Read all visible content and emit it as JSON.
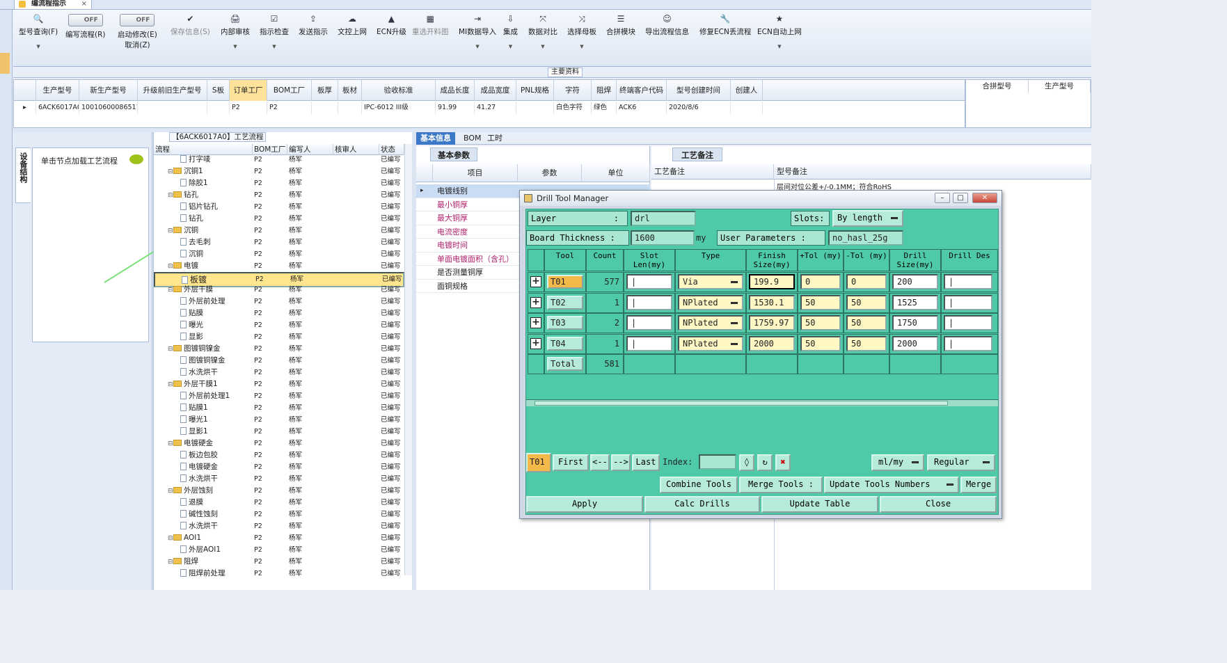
{
  "window": {
    "tab_title": "编流程指示",
    "close_glyph": "×"
  },
  "toolbar": {
    "items": [
      {
        "label": "型号查询(F)",
        "icon": "🔍"
      },
      {
        "label": "编写流程(R)",
        "toggle": "OFF"
      },
      {
        "label": "启动修改(E)",
        "label2": "取消(Z)",
        "toggle": "OFF"
      },
      {
        "label": "保存信息(S)",
        "icon": "✔"
      },
      {
        "label": "内部审核",
        "icon": "🖨"
      },
      {
        "label": "指示检查",
        "icon": "☑"
      },
      {
        "label": "发送指示",
        "icon": "⇪"
      },
      {
        "label": "文控上网",
        "icon": "☁"
      },
      {
        "label": "ECN升级",
        "icon": "▲"
      },
      {
        "label": "重选开料图",
        "icon": "▦"
      },
      {
        "label": "MI数据导入",
        "icon": "⇥"
      },
      {
        "label": "集成",
        "icon": "⇩"
      },
      {
        "label": "数据对比",
        "icon": "⤧"
      },
      {
        "label": "选择母板",
        "icon": "⤨"
      },
      {
        "label": "合拼模块",
        "icon": "☰"
      },
      {
        "label": "导出流程信息",
        "icon": "☺"
      },
      {
        "label": "修复ECN丢流程",
        "icon": "🔧"
      },
      {
        "label": "ECN自动上网",
        "icon": "★"
      }
    ]
  },
  "main_grid": {
    "title": "主要资料",
    "headers": [
      "生产型号",
      "新生产型号",
      "升级前旧生产型号",
      "S板",
      "订单工厂",
      "BOM工厂",
      "板厚",
      "板材",
      "验收标准",
      "成品长度",
      "成品宽度",
      "PNL规格",
      "字符",
      "阻焊",
      "终端客户代码",
      "型号创建时间",
      "创建人"
    ],
    "row": [
      "6ACK6017A0",
      "10010600086517",
      "",
      "",
      "P2",
      "P2",
      "",
      "",
      "IPC-6012 III级",
      "91.99",
      "41.27",
      "",
      "白色字符",
      "绿色",
      "ACK6",
      "2020/8/6",
      ""
    ],
    "side_headers": [
      "合拼型号",
      "生产型号"
    ]
  },
  "side": {
    "vertical_tab": "设备结构",
    "hint": "单击节点加载工艺流程"
  },
  "tree": {
    "title": "【6ACK6017A0】工艺流程",
    "headers": [
      "流程",
      "BOM工厂",
      "编写人",
      "核审人",
      "状态"
    ],
    "rows": [
      {
        "name": "打字唛",
        "level": 2,
        "factory": "P2",
        "writer": "杨军",
        "status": "已编写"
      },
      {
        "name": "沉铜1",
        "level": 1,
        "factory": "P2",
        "writer": "杨军",
        "status": "已编写"
      },
      {
        "name": "除胶1",
        "level": 2,
        "factory": "P2",
        "writer": "杨军",
        "status": "已编写"
      },
      {
        "name": "钻孔",
        "level": 1,
        "factory": "P2",
        "writer": "杨军",
        "status": "已编写"
      },
      {
        "name": "铝片钻孔",
        "level": 2,
        "factory": "P2",
        "writer": "杨军",
        "status": "已编写"
      },
      {
        "name": "钻孔",
        "level": 2,
        "factory": "P2",
        "writer": "杨军",
        "status": "已编写"
      },
      {
        "name": "沉铜",
        "level": 1,
        "factory": "P2",
        "writer": "杨军",
        "status": "已编写"
      },
      {
        "name": "去毛刺",
        "level": 2,
        "factory": "P2",
        "writer": "杨军",
        "status": "已编写"
      },
      {
        "name": "沉铜",
        "level": 2,
        "factory": "P2",
        "writer": "杨军",
        "status": "已编写"
      },
      {
        "name": "电镀",
        "level": 1,
        "factory": "P2",
        "writer": "杨军",
        "status": "已编写"
      },
      {
        "name": "板镀",
        "level": 2,
        "factory": "P2",
        "writer": "杨军",
        "status": "已编写",
        "selected": true
      },
      {
        "name": "外层干膜",
        "level": 1,
        "factory": "P2",
        "writer": "杨军",
        "status": "已编写"
      },
      {
        "name": "外层前处理",
        "level": 2,
        "factory": "P2",
        "writer": "杨军",
        "status": "已编写"
      },
      {
        "name": "贴膜",
        "level": 2,
        "factory": "P2",
        "writer": "杨军",
        "status": "已编写"
      },
      {
        "name": "曝光",
        "level": 2,
        "factory": "P2",
        "writer": "杨军",
        "status": "已编写"
      },
      {
        "name": "显影",
        "level": 2,
        "factory": "P2",
        "writer": "杨军",
        "status": "已编写"
      },
      {
        "name": "图镀铜镍金",
        "level": 1,
        "factory": "P2",
        "writer": "杨军",
        "status": "已编写"
      },
      {
        "name": "图镀铜镍金",
        "level": 2,
        "factory": "P2",
        "writer": "杨军",
        "status": "已编写"
      },
      {
        "name": "水洗烘干",
        "level": 2,
        "factory": "P2",
        "writer": "杨军",
        "status": "已编写"
      },
      {
        "name": "外层干膜1",
        "level": 1,
        "factory": "P2",
        "writer": "杨军",
        "status": "已编写"
      },
      {
        "name": "外层前处理1",
        "level": 2,
        "factory": "P2",
        "writer": "杨军",
        "status": "已编写"
      },
      {
        "name": "贴膜1",
        "level": 2,
        "factory": "P2",
        "writer": "杨军",
        "status": "已编写"
      },
      {
        "name": "曝光1",
        "level": 2,
        "factory": "P2",
        "writer": "杨军",
        "status": "已编写"
      },
      {
        "name": "显影1",
        "level": 2,
        "factory": "P2",
        "writer": "杨军",
        "status": "已编写"
      },
      {
        "name": "电镀硬金",
        "level": 1,
        "factory": "P2",
        "writer": "杨军",
        "status": "已编写"
      },
      {
        "name": "板边包胶",
        "level": 2,
        "factory": "P2",
        "writer": "杨军",
        "status": "已编写"
      },
      {
        "name": "电镀硬金",
        "level": 2,
        "factory": "P2",
        "writer": "杨军",
        "status": "已编写"
      },
      {
        "name": "水洗烘干",
        "level": 2,
        "factory": "P2",
        "writer": "杨军",
        "status": "已编写"
      },
      {
        "name": "外层蚀刻",
        "level": 1,
        "factory": "P2",
        "writer": "杨军",
        "status": "已编写"
      },
      {
        "name": "退膜",
        "level": 2,
        "factory": "P2",
        "writer": "杨军",
        "status": "已编写"
      },
      {
        "name": "碱性蚀刻",
        "level": 2,
        "factory": "P2",
        "writer": "杨军",
        "status": "已编写"
      },
      {
        "name": "水洗烘干",
        "level": 2,
        "factory": "P2",
        "writer": "杨军",
        "status": "已编写"
      },
      {
        "name": "AOI1",
        "level": 1,
        "factory": "P2",
        "writer": "杨军",
        "status": "已编写"
      },
      {
        "name": "外层AOI1",
        "level": 2,
        "factory": "P2",
        "writer": "杨军",
        "status": "已编写"
      },
      {
        "name": "阻焊",
        "level": 1,
        "factory": "P2",
        "writer": "杨军",
        "status": "已编写"
      },
      {
        "name": "阻焊前处理",
        "level": 2,
        "factory": "P2",
        "writer": "杨军",
        "status": "已编写"
      }
    ]
  },
  "info_tabs": [
    "基本信息",
    "BOM",
    "工时"
  ],
  "basic": {
    "subtab": "基本参数",
    "headers": [
      "项目",
      "参数",
      "单位"
    ],
    "rows": [
      {
        "label": "电镀线别",
        "pink": false,
        "current": true
      },
      {
        "label": "最小铜厚",
        "pink": true
      },
      {
        "label": "最大铜厚",
        "pink": true
      },
      {
        "label": "电流密度",
        "pink": true
      },
      {
        "label": "电镀时间",
        "pink": true
      },
      {
        "label": "单面电镀面积（含孔）",
        "pink": true
      },
      {
        "label": "是否测量铜厚",
        "pink": false
      },
      {
        "label": "面铜规格",
        "pink": false
      }
    ]
  },
  "notes": {
    "tab": "工艺备注",
    "col1": "工艺备注",
    "col2": "型号备注",
    "text": "层间对位公差+/-0.1MM；符合RoHS"
  },
  "drill": {
    "title": "Drill Tool Manager",
    "layer_label": "Layer",
    "layer_sep": ":",
    "layer": "drl",
    "slots_label": "Slots:",
    "slots_value": "By length",
    "thickness_label": "Board Thickness :",
    "thickness": "1600",
    "thickness_unit": "my",
    "user_params_label": "User Parameters :",
    "user_params": "no_hasl_25g",
    "headers": [
      "Tool",
      "Count",
      "Slot Len(my)",
      "Type",
      "Finish Size(my)",
      "+Tol (my)",
      "-Tol (my)",
      "Drill Size(my)",
      "Drill Des"
    ],
    "rows": [
      {
        "tool": "T01",
        "count": "577",
        "type": "Via",
        "finish": "199.9",
        "ptol": "0",
        "mtol": "0",
        "drill": "200",
        "current": true
      },
      {
        "tool": "T02",
        "count": "1",
        "type": "NPlated",
        "finish": "1530.1",
        "ptol": "50",
        "mtol": "50",
        "drill": "1525"
      },
      {
        "tool": "T03",
        "count": "2",
        "type": "NPlated",
        "finish": "1759.97",
        "ptol": "50",
        "mtol": "50",
        "drill": "1750"
      },
      {
        "tool": "T04",
        "count": "1",
        "type": "NPlated",
        "finish": "2000",
        "ptol": "50",
        "mtol": "50",
        "drill": "2000"
      }
    ],
    "total_label": "Total",
    "total": "581",
    "nav": {
      "current": "T01",
      "first": "First",
      "prev": "<--",
      "next": "-->",
      "last": "Last",
      "index_label": "Index:",
      "units": "ml/my",
      "mode": "Regular"
    },
    "buttons": {
      "combine": "Combine Tools",
      "merge_tools": "Merge Tools :",
      "update_numbers": "Update Tools Numbers",
      "merge": "Merge",
      "apply": "Apply",
      "calc": "Calc Drills",
      "update_table": "Update Table",
      "close": "Close"
    }
  }
}
